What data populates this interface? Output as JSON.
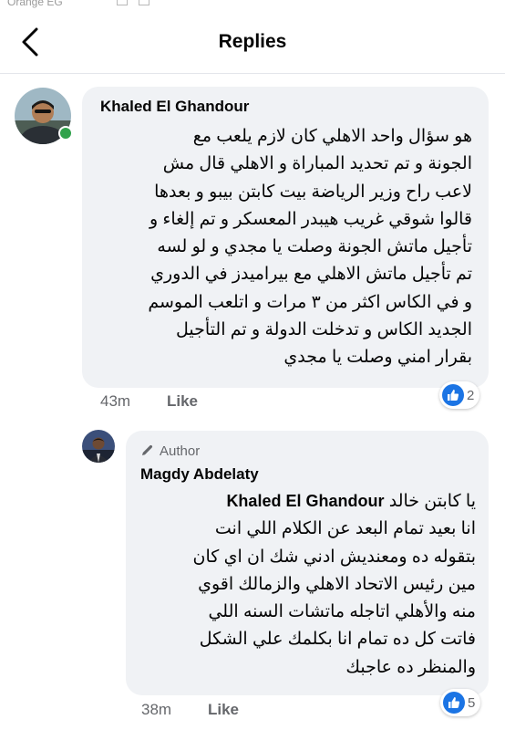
{
  "status_bar": {
    "carrier": "Orange EG"
  },
  "header": {
    "title": "Replies"
  },
  "comment": {
    "author": "Khaled El Ghandour",
    "lines": [
      "هو سؤال واحد الاهلي كان لازم يلعب مع",
      "الجونة و تم تحديد المباراة و الاهلي قال مش",
      "لاعب راح وزير الرياضة بيت كابتن بيبو و بعدها",
      "قالوا شوقي غريب هيبدر المعسكر و تم إلغاء و",
      "تأجيل ماتش الجونة وصلت يا مجدي و لو لسه",
      "تم تأجيل ماتش الاهلي مع بيراميدز في الدوري",
      "و في الكاس اكثر من ٣ مرات و اتلعب الموسم",
      "الجديد الكاس  و تدخلت الدولة و تم التأجيل",
      "بقرار امني وصلت يا مجدي"
    ],
    "time": "43m",
    "like_label": "Like",
    "reaction_count": "2"
  },
  "reply": {
    "badge": "Author",
    "author": "Magdy Abdelaty",
    "mention": "Khaled El Ghandour",
    "first_line_text": "يا كابتن خالد",
    "lines": [
      "انا بعيد تمام البعد عن الكلام اللي انت",
      "بتقوله ده ومعنديش ادني شك ان اي كان",
      "مين رئيس الاتحاد الاهلي والزمالك اقوي",
      "منه والأهلي اتاجله ماتشات السنه اللي",
      "فاتت كل ده تمام انا بكلمك علي الشكل",
      "والمنظر ده عاجبك"
    ],
    "time": "38m",
    "like_label": "Like",
    "reaction_count": "5"
  },
  "colors": {
    "like_blue": "#1b74e4",
    "online_green": "#31a24c",
    "bubble_bg": "#f0f2f5",
    "meta_gray": "#65676b"
  },
  "icons": {
    "back": "chevron-left-icon",
    "author_badge": "pencil-icon",
    "reaction": "thumbs-up-icon"
  }
}
